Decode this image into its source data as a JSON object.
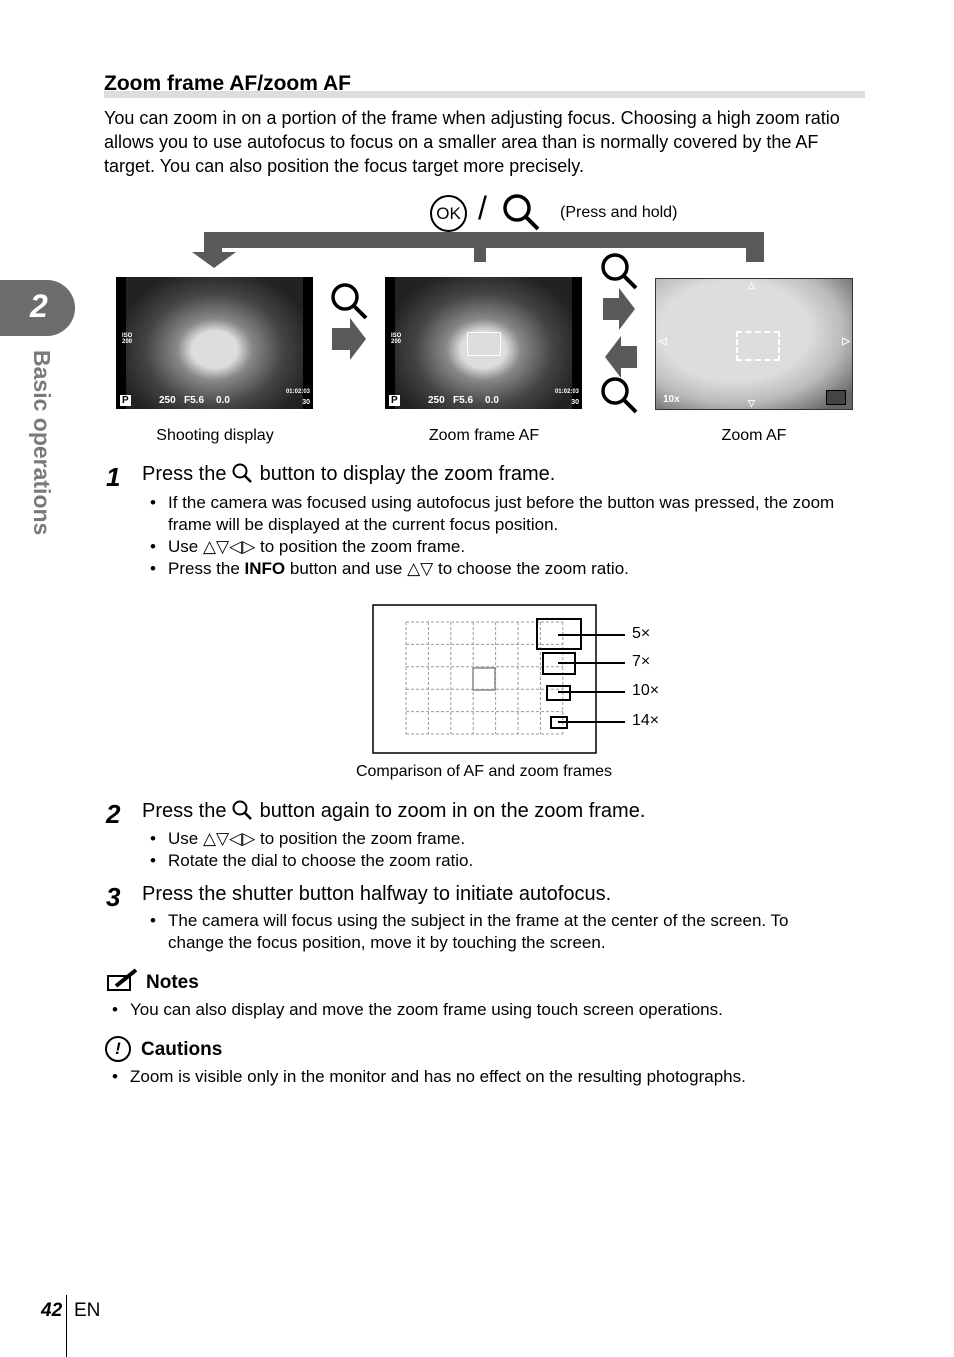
{
  "title": "Zoom frame AF/zoom AF",
  "intro": "You can zoom in on a portion of the frame when adjusting focus. Choosing a high zoom ratio allows you to use autofocus to focus on a smaller area than is normally covered by the AF target. You can also position the focus target more precisely.",
  "sidebar": {
    "chapter": "2",
    "label": "Basic operations"
  },
  "flow": {
    "ok_label": "OK",
    "slash": "/",
    "press_hold": "(Press and hold)",
    "screens": [
      {
        "caption": "Shooting display",
        "mode": "P",
        "shutter": "250",
        "aperture": "F5.6",
        "ev": "0.0",
        "iso": "ISO 200",
        "time": "01:02:03",
        "count": "30"
      },
      {
        "caption": "Zoom frame AF",
        "mode": "P",
        "shutter": "250",
        "aperture": "F5.6",
        "ev": "0.0",
        "iso": "ISO 200",
        "time": "01:02:03",
        "count": "30"
      },
      {
        "caption": "Zoom AF",
        "zoom": "10x"
      }
    ]
  },
  "steps": [
    {
      "num": "1",
      "pre": "Press the",
      "post": "button to display the zoom frame.",
      "bullets": [
        "If the camera was focused using autofocus just before the button was pressed, the zoom frame will be displayed at the current focus position."
      ],
      "use_pre": "Use",
      "use_post": "to position the zoom frame.",
      "info_pre": "Press the",
      "info_bold": "INFO",
      "info_mid": "button and use",
      "info_post": "to choose the zoom ratio."
    },
    {
      "num": "2",
      "pre": "Press the",
      "post": "button again to zoom in on the zoom frame.",
      "use_pre": "Use",
      "use_post": "to position the zoom frame.",
      "bullets": [
        "Rotate the dial to choose the zoom ratio."
      ]
    },
    {
      "num": "3",
      "text": "Press the shutter button halfway to initiate autofocus.",
      "bullets": [
        "The camera will focus using the subject in the frame at the center of the screen. To change the focus position, move it by touching the screen."
      ]
    }
  ],
  "comparison": {
    "caption": "Comparison of AF and zoom frames",
    "labels": [
      "5×",
      "7×",
      "10×",
      "14×"
    ]
  },
  "notes": {
    "heading": "Notes",
    "items": [
      "You can also display and move the zoom frame using touch screen operations."
    ]
  },
  "cautions": {
    "heading": "Cautions",
    "items": [
      "Zoom is visible only in the monitor and has no effect on the resulting photographs."
    ]
  },
  "footer": {
    "page": "42",
    "lang": "EN"
  },
  "colors": {
    "tab": "#6d6d6d",
    "arrow": "#5a5a5a",
    "titlebar": "#dddddd"
  }
}
